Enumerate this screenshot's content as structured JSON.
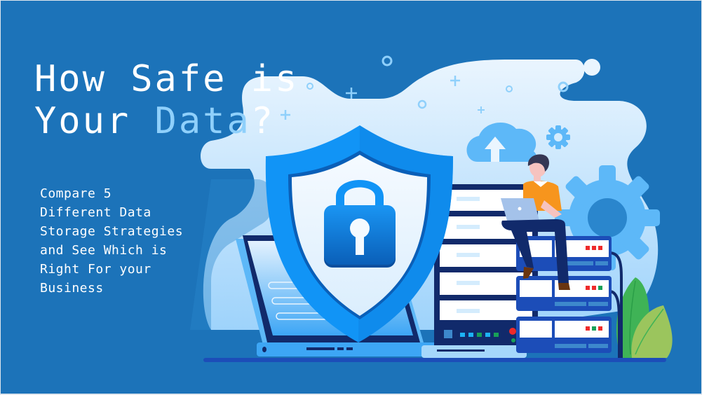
{
  "banner": {
    "headline": {
      "line1": "How Safe is",
      "line2_prefix": "Your ",
      "line2_accent": "Data",
      "line2_suffix": "?"
    },
    "subheadline_lines": [
      "Compare 5",
      "Different Data",
      "Storage Strategies",
      "and See Which is",
      "Right For your",
      "Business"
    ],
    "colors": {
      "background": "#1c73b9",
      "headline": "#ffffff",
      "accent": "#8fd0fb",
      "shield_outer": "#1194f6",
      "shield_inner": "#eef6fe",
      "server_dark": "#112a6b",
      "shirt": "#f7951d",
      "plant_dark": "#3fb356",
      "plant_light": "#9bc55d"
    },
    "illustration": {
      "icons": [
        "shield-lock-icon",
        "laptop-icon",
        "server-rack-icon",
        "server-stack-icon",
        "cloud-upload-icon",
        "gear-icon",
        "person-with-laptop",
        "plant-icon"
      ],
      "server_status_lights": [
        [
          "red",
          "red",
          "red"
        ],
        [
          "red",
          "red",
          "green"
        ],
        [
          "red",
          "green",
          "red"
        ]
      ]
    }
  }
}
